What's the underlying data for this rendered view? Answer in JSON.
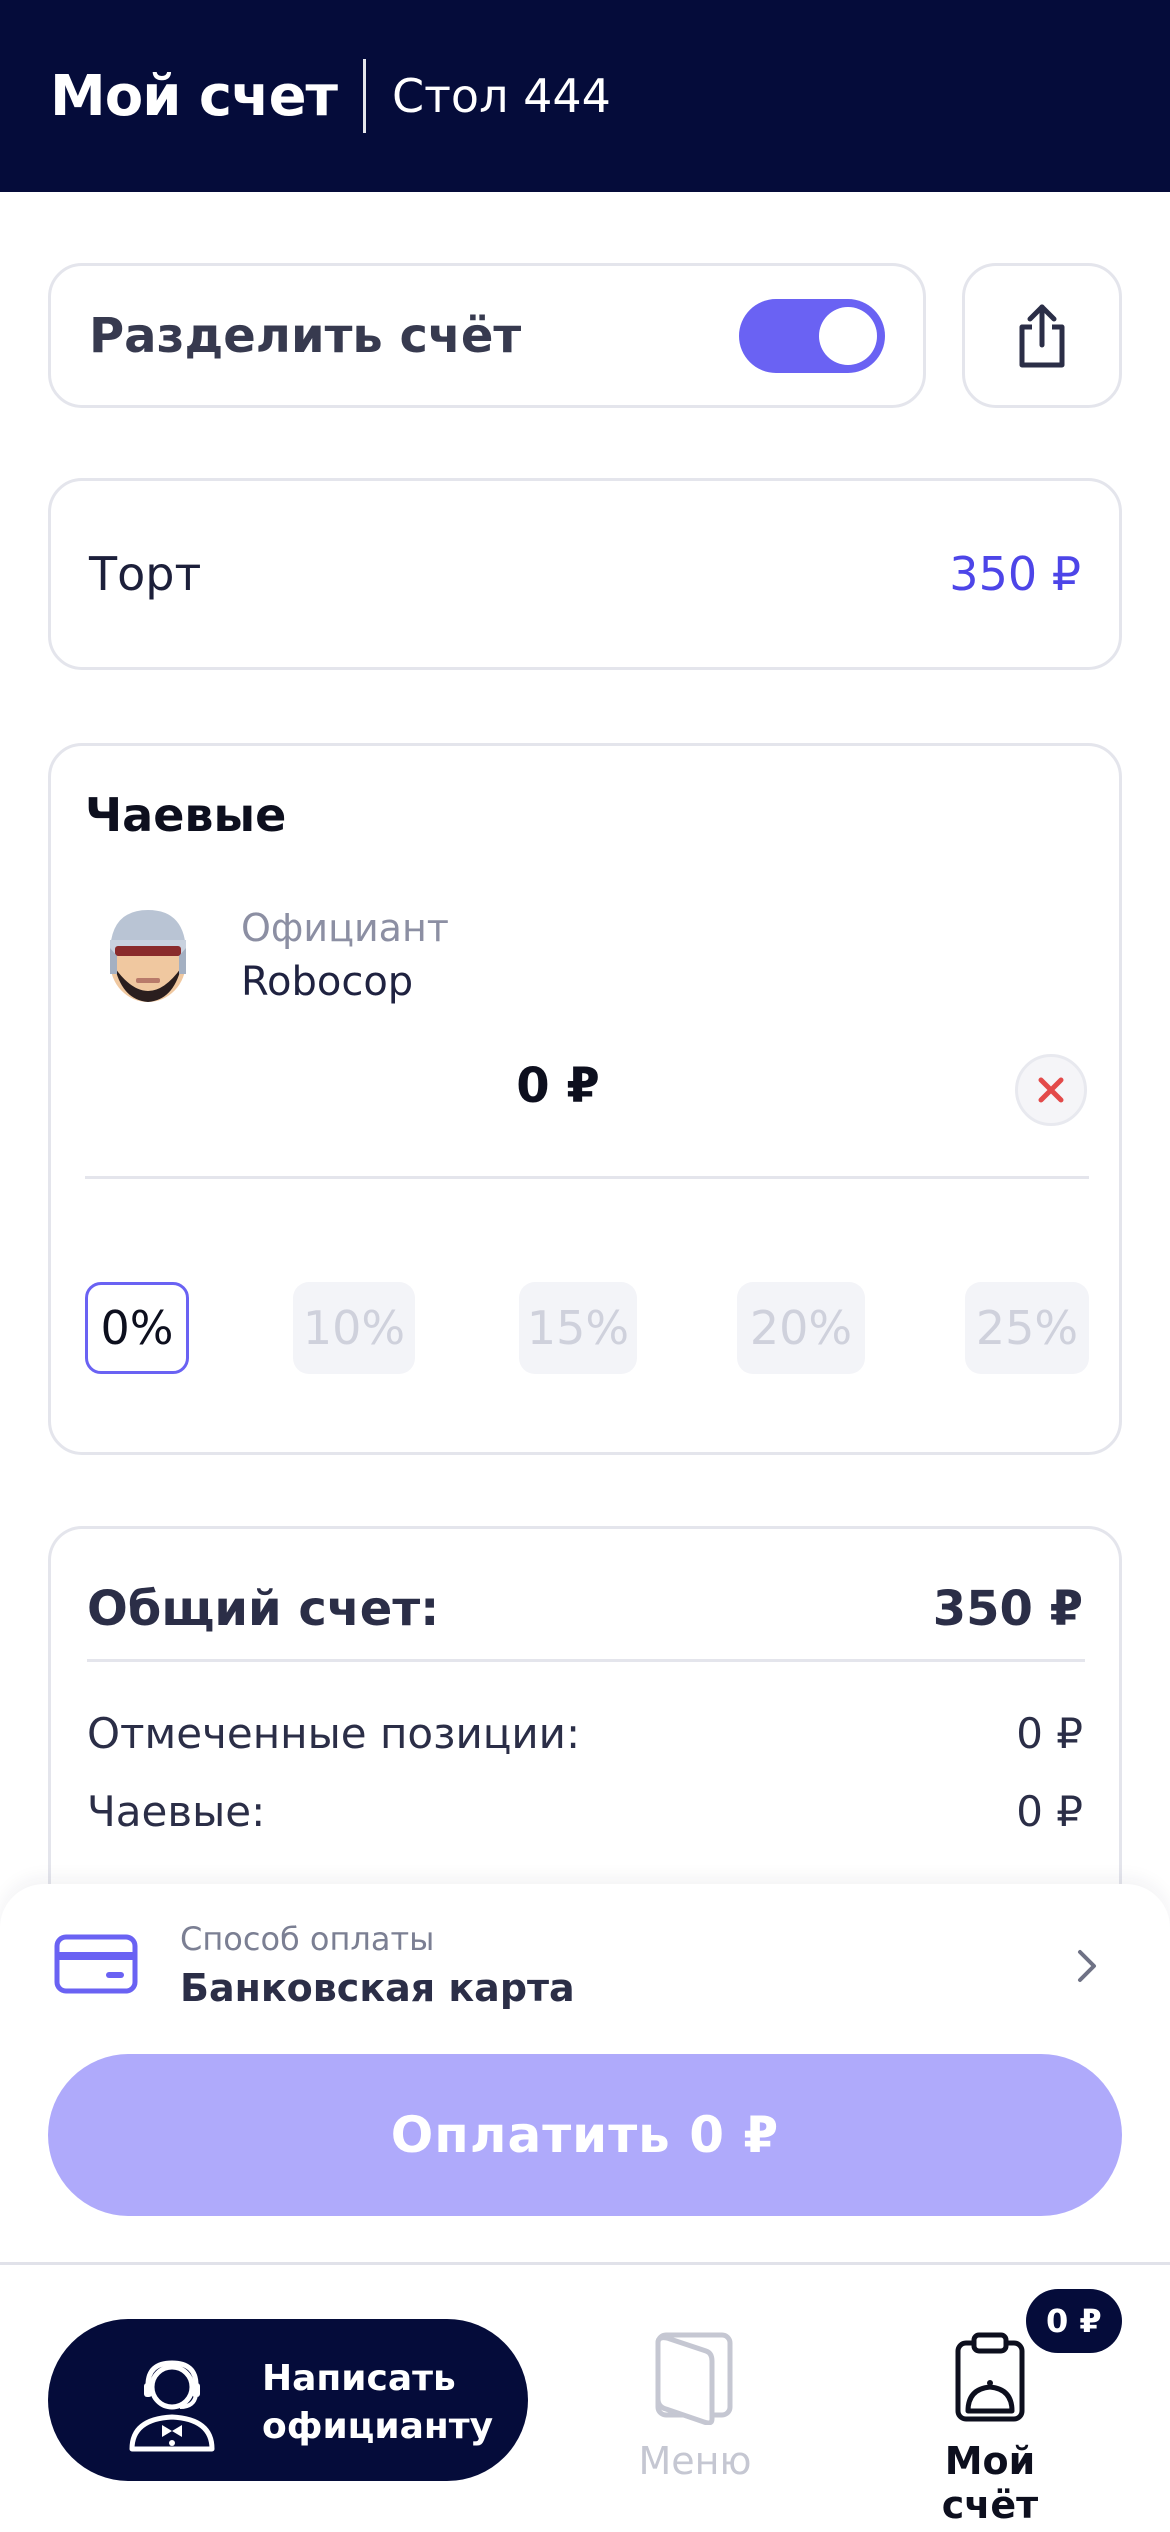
{
  "header": {
    "title": "Мой счет",
    "table": "Стол 444"
  },
  "split": {
    "label": "Разделить счёт",
    "enabled": true
  },
  "order_item": {
    "name": "Торт",
    "price": "350 ₽"
  },
  "tips": {
    "heading": "Чаевые",
    "waiter_role": "Официант",
    "waiter_name": "Robocop",
    "amount": "0 ₽",
    "options": [
      "0%",
      "10%",
      "15%",
      "20%",
      "25%"
    ],
    "selected": "0%"
  },
  "total": {
    "label": "Общий счет:",
    "value": "350 ₽",
    "rows": [
      {
        "label": "Отмеченные позиции:",
        "value": "0 ₽"
      },
      {
        "label": "Чаевые:",
        "value": "0 ₽"
      }
    ]
  },
  "payment": {
    "method_label": "Способ оплаты",
    "method_value": "Банковская карта",
    "pay_button": "Оплатить 0 ₽"
  },
  "nav": {
    "call_waiter": "Написать официанту",
    "menu": "Меню",
    "my_bill": "Мой счёт",
    "bill_badge": "0 ₽"
  },
  "colors": {
    "header_bg": "#050c3a",
    "accent": "#6a62f3",
    "price": "#4d45e8",
    "pay_button": "#afaafb",
    "clear_x": "#e34a4a"
  }
}
